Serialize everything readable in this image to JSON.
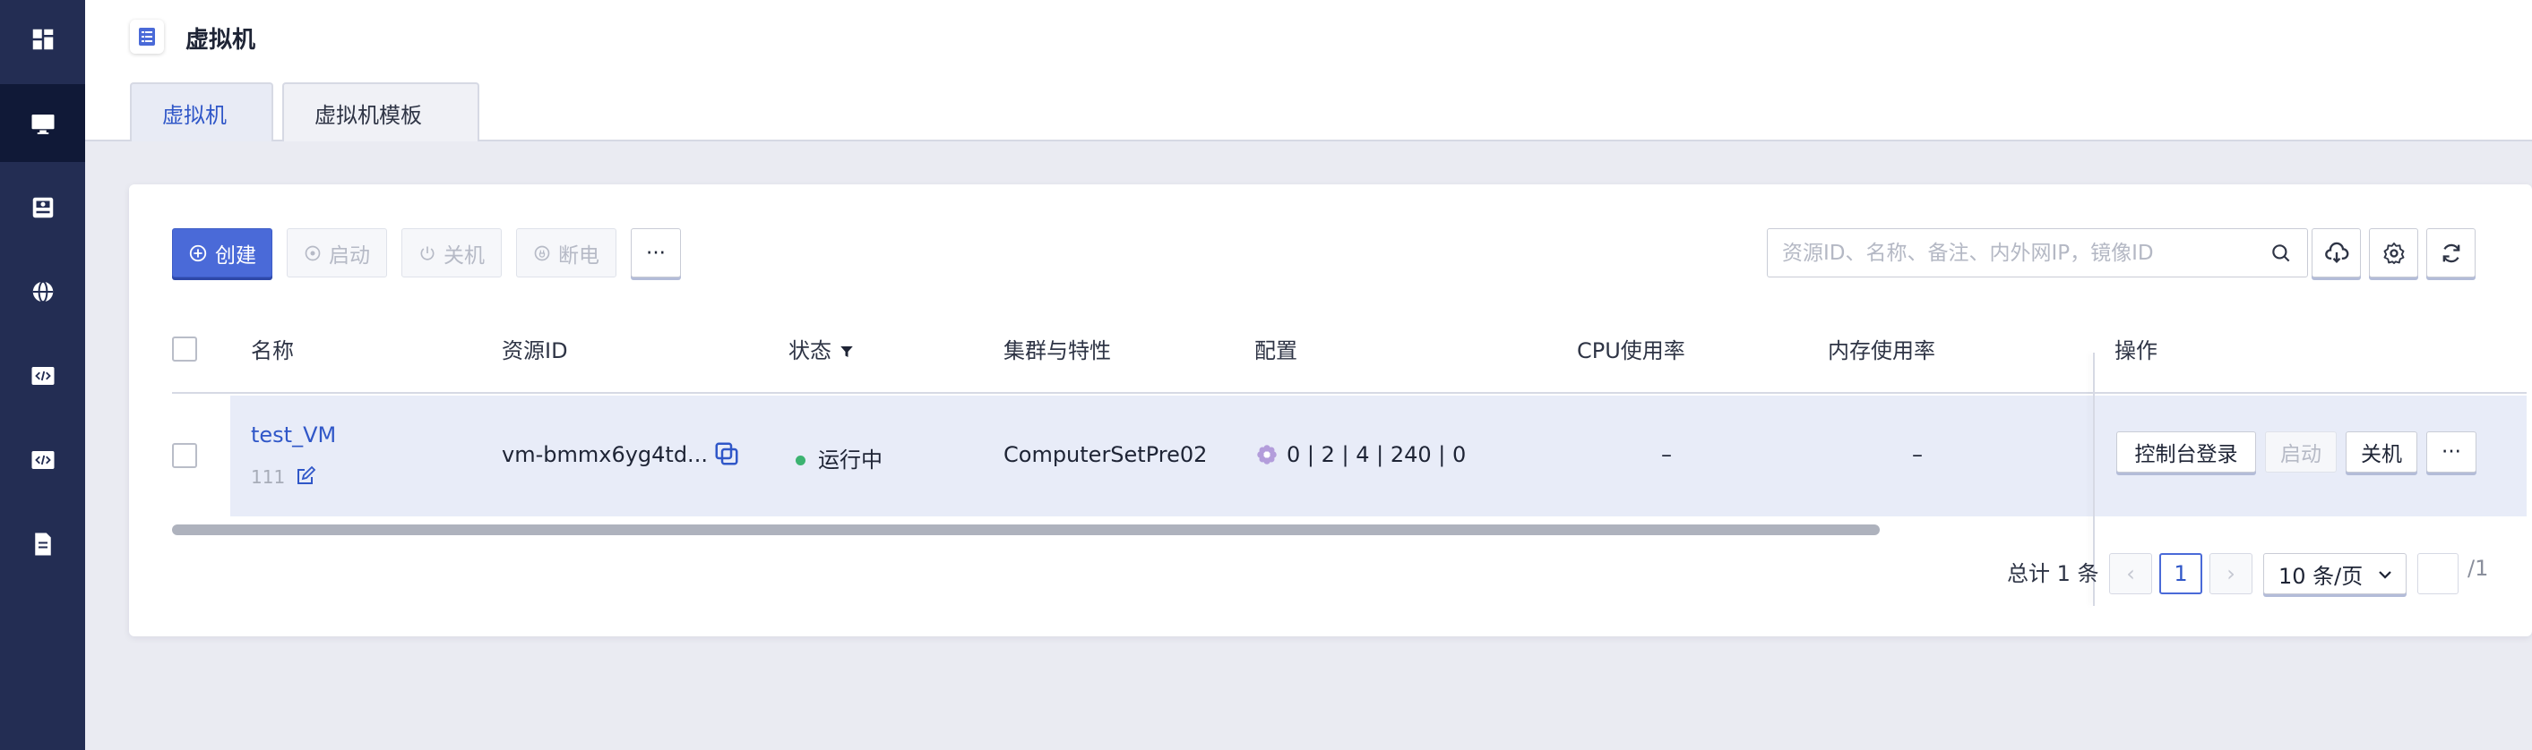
{
  "sidebar": {
    "items": [
      {
        "icon": "dashboard-icon"
      },
      {
        "icon": "monitor-icon",
        "active": true
      },
      {
        "icon": "storage-icon"
      },
      {
        "icon": "globe-icon"
      },
      {
        "icon": "code-window-icon"
      },
      {
        "icon": "code-window-icon"
      },
      {
        "icon": "document-icon"
      }
    ]
  },
  "header": {
    "title": "虚拟机",
    "tabs": [
      {
        "label": "虚拟机",
        "active": true
      },
      {
        "label": "虚拟机模板",
        "active": false
      }
    ]
  },
  "toolbar": {
    "create_label": "创建",
    "start_label": "启动",
    "shutdown_label": "关机",
    "poweroff_label": "断电",
    "more_label": "···",
    "search_placeholder": "资源ID、名称、备注、内外网IP，镜像ID"
  },
  "table": {
    "columns": [
      "名称",
      "资源ID",
      "状态",
      "集群与特性",
      "配置",
      "CPU使用率",
      "内存使用率",
      "操作"
    ],
    "rows": [
      {
        "name": "test_VM",
        "remark": "111",
        "resource_id": "vm-bmmx6yg4td...",
        "status": "运行中",
        "cluster": "ComputerSetPre02",
        "config": "0 | 2 | 4 | 240 | 0",
        "cpu_usage": "–",
        "mem_usage": "–",
        "actions": {
          "console": "控制台登录",
          "start": "启动",
          "shutdown": "关机",
          "more": "···"
        }
      }
    ]
  },
  "pagination": {
    "total_text": "总计 1 条",
    "prev": "‹",
    "current_page": "1",
    "next": "›",
    "page_size": "10 条/页",
    "page_total": "/1"
  },
  "colors": {
    "sidebar_bg": "#232d53",
    "primary": "#4a6ad8",
    "link": "#3057c8",
    "status_running": "#3cb371",
    "row_highlight": "#e8ecf8"
  }
}
